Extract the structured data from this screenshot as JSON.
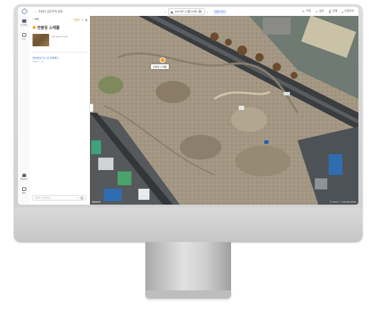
{
  "topbar": {
    "back_label": "[대지] 공동주택 현장",
    "prev_arrow": "‹",
    "date": "2023년 11월 20일 (월)",
    "next_arrow": "›",
    "compare_label": "현장 비교",
    "actions": [
      "수정",
      "공유",
      "인쇄",
      "다운로드"
    ]
  },
  "rail": {
    "items": [
      "프로젝트",
      "사진",
      "알림센터",
      "패널"
    ]
  },
  "panel": {
    "back_label": "목록",
    "status_badge": "진행중",
    "title": "안봉징 스케줄",
    "thumb_caption": "사진 2023-11-20",
    "note_link": "현장점검 지시 및 공정확인",
    "note_meta": "Sketch · 11",
    "comment_placeholder": "댓글을 입력하세요"
  },
  "map": {
    "popup_label": "안봉징 스케줄",
    "attribution": "© Vworld · © OpenStreetMap",
    "logo_text": "Vworld"
  },
  "icons": {
    "logo": "app-logo-icon",
    "edit": "pencil-icon",
    "share": "share-icon",
    "print": "printer-icon",
    "download": "download-icon"
  },
  "colors": {
    "accent_blue": "#3b7bd6",
    "accent_orange": "#f09a1c",
    "bezel": "#d4d4d4"
  }
}
